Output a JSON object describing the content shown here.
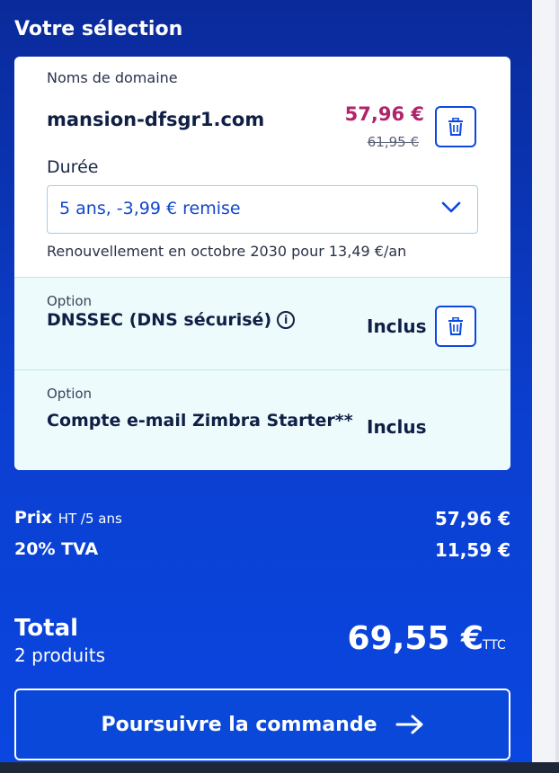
{
  "title": "Votre sélection",
  "card": {
    "section_label": "Noms de domaine",
    "domain": "mansion-dfsgr1.com",
    "price_new": "57,96 €",
    "price_old": "61,95 €",
    "duration_label": "Durée",
    "duration_value": "5 ans, -3,99 € remise",
    "renewal": "Renouvellement en octobre 2030 pour 13,49 €/an"
  },
  "options": [
    {
      "label": "Option",
      "name": "DNSSEC (DNS sécurisé)",
      "status": "Inclus"
    },
    {
      "label": "Option",
      "name": "Compte e-mail Zimbra Starter**",
      "status": "Inclus"
    }
  ],
  "summary": {
    "price_label": "Prix",
    "price_sub": "HT /5 ans",
    "price_value": "57,96 €",
    "tva_label": "20% TVA",
    "tva_value": "11,59 €",
    "total_label": "Total",
    "total_count": "2 produits",
    "total_value": "69,55 €",
    "total_suffix": "TTC"
  },
  "cta_label": "Poursuivre la commande",
  "icons": {
    "delete": "trash-icon",
    "info": "info-icon",
    "dropdown": "chevron-down-icon",
    "arrow": "arrow-right-icon"
  },
  "colors": {
    "accent": "#0b49e2",
    "price": "#b0246a",
    "background": "#0a2a9a"
  }
}
